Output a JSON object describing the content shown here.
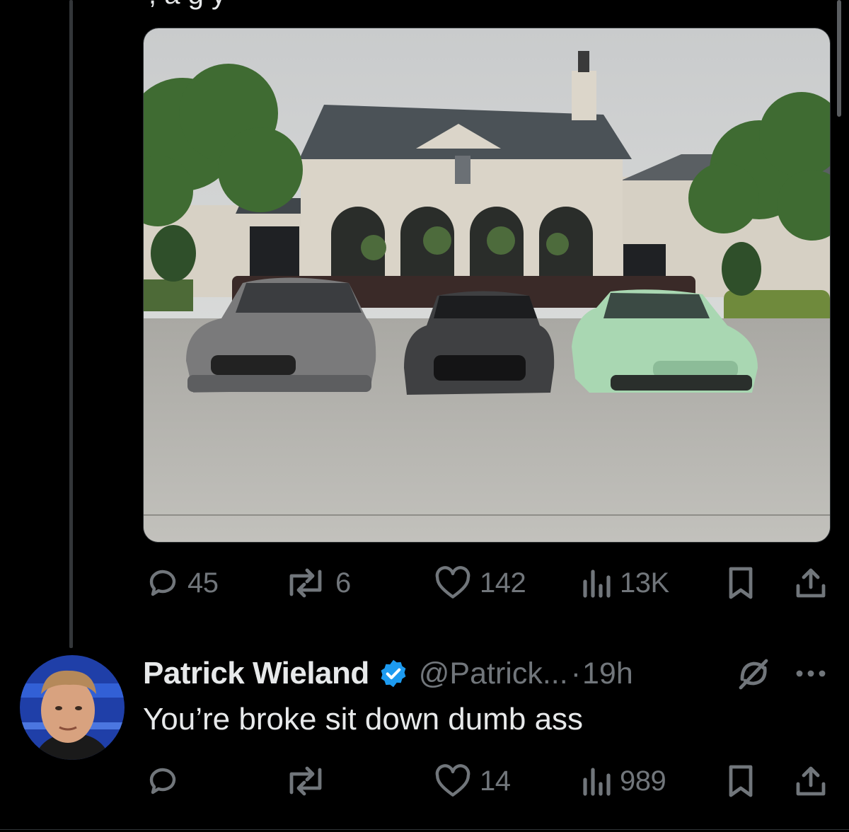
{
  "partial_text_above": ", a  g  y",
  "post": {
    "image_alt": "Three sports cars parked in front of a gated building",
    "actions": {
      "replies": "45",
      "reposts": "6",
      "likes": "142",
      "views": "13K"
    }
  },
  "reply": {
    "name": "Patrick Wieland",
    "handle": "@Patrick...",
    "separator": "·",
    "time": "19h",
    "text": "You’re broke sit down dumb ass",
    "actions": {
      "replies": "",
      "reposts": "",
      "likes": "14",
      "views": "989"
    }
  },
  "colors": {
    "background": "#000000",
    "text": "#e7e9ea",
    "muted": "#71767b",
    "verified": "#1d9bf0"
  },
  "icons": [
    "reply-icon",
    "repost-icon",
    "like-icon",
    "views-icon",
    "bookmark-icon",
    "share-icon",
    "verified-badge-icon",
    "grok-icon",
    "more-icon"
  ]
}
